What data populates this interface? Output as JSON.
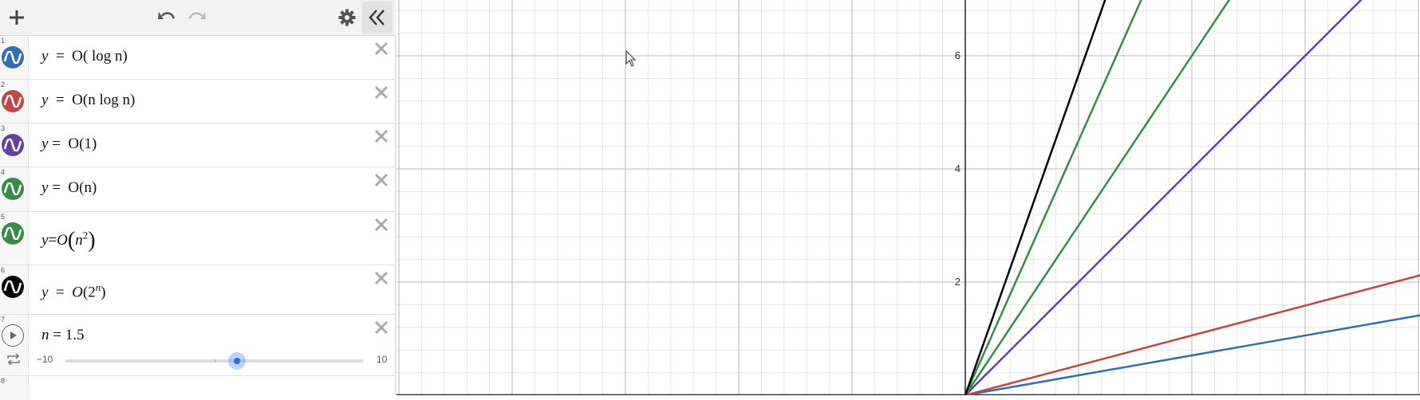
{
  "toolbar": {
    "add_icon": "plus-icon",
    "undo_icon": "undo-icon",
    "redo_icon": "redo-icon",
    "settings_icon": "gear-icon",
    "collapse_icon": "double-chevron-left-icon"
  },
  "expressions": [
    {
      "index": "1",
      "color": "#2d70b3",
      "lhs": "y",
      "eq": "=",
      "text": "O( log n)"
    },
    {
      "index": "2",
      "color": "#c74440",
      "lhs": "y",
      "eq": "=",
      "text": "O(n log n)"
    },
    {
      "index": "3",
      "color": "#6042a6",
      "lhs": "y",
      "eq": "=",
      "text": "O(1)"
    },
    {
      "index": "4",
      "color": "#388c46",
      "lhs": "y",
      "eq": "=",
      "text": "O(n)"
    },
    {
      "index": "5",
      "color": "#388c46",
      "lhs": "y",
      "eq": "=",
      "text": "O(n2)",
      "base": "n",
      "exp": "2"
    },
    {
      "index": "6",
      "color": "#000000",
      "lhs": "y",
      "eq": "=",
      "text": "O(2n)",
      "base": "2",
      "exp": "n"
    }
  ],
  "slider": {
    "index": "7",
    "variable": "n",
    "eq": "=",
    "value": "1.5",
    "value_num": 1.5,
    "min": "−10",
    "max": "10",
    "min_num": -10,
    "max_num": 10
  },
  "empty_row_index": "8",
  "graph": {
    "y_tick_labels": [
      "2",
      "4",
      "6"
    ],
    "x_range": [
      -10,
      8
    ],
    "y_range": [
      -0.1,
      7
    ],
    "lines": [
      {
        "name": "log",
        "color": "#2d70b3",
        "slope": 0.176
      },
      {
        "name": "nlogn",
        "color": "#c74440",
        "slope": 0.264
      },
      {
        "name": "const",
        "color": "#6042a6",
        "slope": 1.0
      },
      {
        "name": "n",
        "color": "#388c46",
        "slope": 1.5
      },
      {
        "name": "n2",
        "color": "#388c46",
        "slope": 2.25
      },
      {
        "name": "2n",
        "color": "#000000",
        "slope": 2.83
      }
    ]
  }
}
